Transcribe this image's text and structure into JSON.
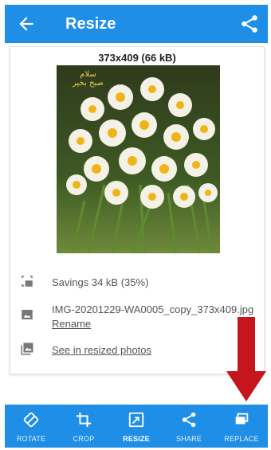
{
  "appbar": {
    "title": "Resize",
    "back_icon": "arrow-left-icon",
    "share_icon": "share-icon",
    "color": "#1e8ee6"
  },
  "card": {
    "dimensions": "373x409 (66 kB)",
    "watermark": [
      "سلام",
      "صبح بخير"
    ],
    "savings": "Savings 34 kB (35%)",
    "filename": "IMG-20201229-WA0005_copy_373x409.jpg",
    "rename": "Rename",
    "see_resized": "See in resized photos"
  },
  "toolbar": {
    "items": [
      {
        "label": "ROTATE",
        "icon": "rotate-icon"
      },
      {
        "label": "CROP",
        "icon": "crop-icon"
      },
      {
        "label": "RESIZE",
        "icon": "resize-icon",
        "active": true
      },
      {
        "label": "SHARE",
        "icon": "share-icon"
      },
      {
        "label": "REPLACE",
        "icon": "replace-icon"
      }
    ]
  },
  "annotation": {
    "arrow_color": "#c4161c"
  }
}
